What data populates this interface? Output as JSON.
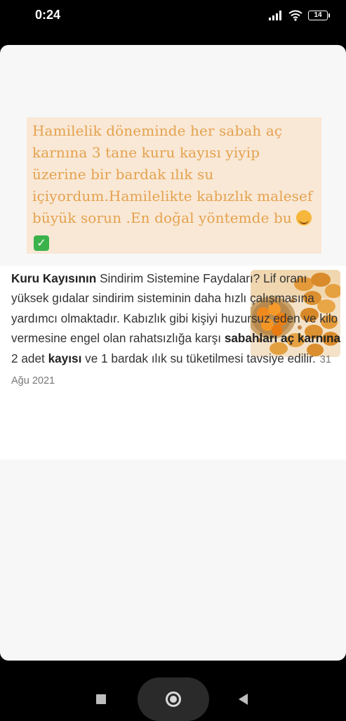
{
  "status_bar": {
    "time": "0:24",
    "battery": "14"
  },
  "caption": {
    "text": "Hamilelik döneminde her sabah aç karnına 3 tane kuru kayısı yiyip üzerine bir bardak ılık su içiyordum.Hamilelikte kabızlık malesef büyük sorun .En doğal yöntemde bu",
    "emoji_1": "smiling-face-with-hearts-icon",
    "emoji_2": "check-mark-button-icon"
  },
  "snippet": {
    "title_bold": "Kuru Kayısının",
    "part_1": " Sindirim Sistemine Faydaları? Lif oranı yüksek gıdalar sindirim sisteminin daha hızlı çalışmasına yardımcı olmaktadır. Kabızlık gibi kişiyi huzursuz eden ve kilo vermesine engel olan rahatsızlığa karşı ",
    "bold_2": "sabahları aç karnına",
    "part_2": " 2 adet ",
    "bold_3": "kayısı",
    "part_3": " ve 1 bardak ılık su tüketilmesi tavsiye edilir.",
    "date": "31 Ağu 2021",
    "image": "dried-apricots-image"
  },
  "nav_bar": {
    "recents": "square-icon",
    "home": "home-circle-icon",
    "back": "back-triangle-icon"
  },
  "colors": {
    "caption_text": "#e4a24e",
    "caption_bg": "#f9e8d6",
    "card_bg": "#f7f7f7"
  }
}
